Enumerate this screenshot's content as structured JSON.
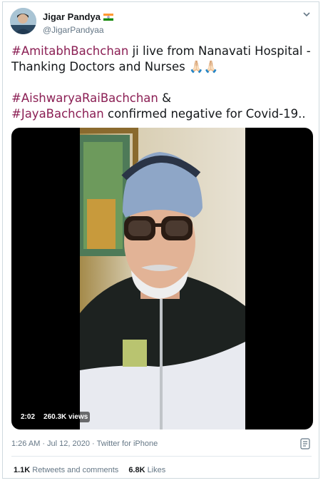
{
  "user": {
    "display_name": "Jigar Pandya",
    "handle": "@JigarPandyaa"
  },
  "tweet": {
    "line1_hashtag": "#AmitabhBachchan",
    "line1_rest": " ji live from Nanavati Hospital -",
    "line2": "Thanking Doctors and Nurses",
    "line2_emoji": " 🙏🏻🙏🏻",
    "line3_hashtag": "#AishwaryaRaiBachchan",
    "line3_rest": " &",
    "line4_hashtag": "#JayaBachchan",
    "line4_rest": "  confirmed negative for Covid-19.."
  },
  "video": {
    "duration": "2:02",
    "views": "260.3K views"
  },
  "meta": {
    "time": "1:26 AM",
    "date": "Jul 12, 2020",
    "source": "Twitter for iPhone"
  },
  "stats": {
    "retweets_count": "1.1K",
    "retweets_label": "Retweets and comments",
    "likes_count": "6.8K",
    "likes_label": "Likes"
  },
  "colors": {
    "hashtag": "#8b1f54",
    "secondary_text": "#657786",
    "border": "#cfd9de"
  }
}
